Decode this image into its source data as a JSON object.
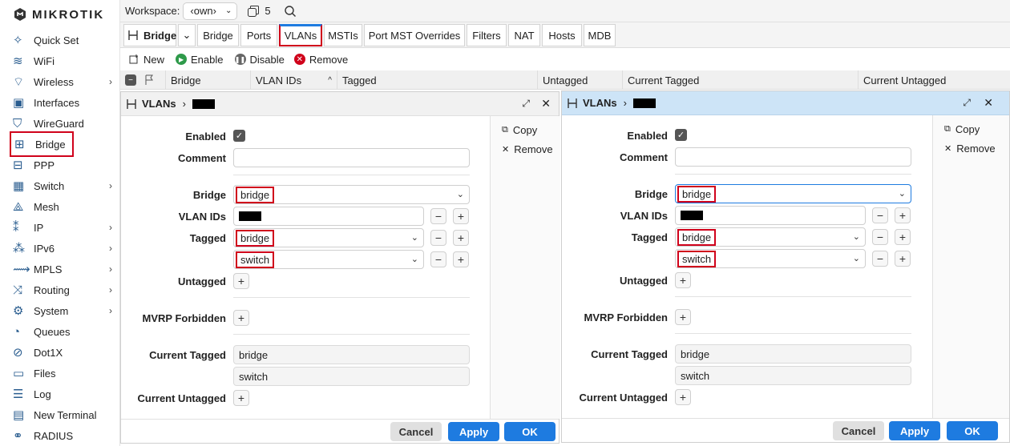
{
  "sidebar": {
    "logo": "MikroTik",
    "items": [
      {
        "label": "Quick Set",
        "icon": "wand-icon",
        "arrow": false
      },
      {
        "label": "WiFi",
        "icon": "wifi-icon",
        "arrow": false
      },
      {
        "label": "Wireless",
        "icon": "wireless-icon",
        "arrow": true
      },
      {
        "label": "Interfaces",
        "icon": "interfaces-icon",
        "arrow": false
      },
      {
        "label": "WireGuard",
        "icon": "wireguard-icon",
        "arrow": false
      },
      {
        "label": "Bridge",
        "icon": "bridge-icon",
        "arrow": false
      },
      {
        "label": "PPP",
        "icon": "ppp-icon",
        "arrow": false
      },
      {
        "label": "Switch",
        "icon": "switch-icon",
        "arrow": true
      },
      {
        "label": "Mesh",
        "icon": "mesh-icon",
        "arrow": false
      },
      {
        "label": "IP",
        "icon": "ip-icon",
        "arrow": true
      },
      {
        "label": "IPv6",
        "icon": "ipv6-icon",
        "arrow": true
      },
      {
        "label": "MPLS",
        "icon": "mpls-icon",
        "arrow": true
      },
      {
        "label": "Routing",
        "icon": "routing-icon",
        "arrow": true
      },
      {
        "label": "System",
        "icon": "gear-icon",
        "arrow": true
      },
      {
        "label": "Queues",
        "icon": "queues-icon",
        "arrow": false
      },
      {
        "label": "Dot1X",
        "icon": "dot1x-icon",
        "arrow": false
      },
      {
        "label": "Files",
        "icon": "folder-icon",
        "arrow": false
      },
      {
        "label": "Log",
        "icon": "log-icon",
        "arrow": false
      },
      {
        "label": "New Terminal",
        "icon": "terminal-icon",
        "arrow": false
      },
      {
        "label": "RADIUS",
        "icon": "radius-icon",
        "arrow": false
      }
    ]
  },
  "topbar": {
    "workspace_label": "Workspace:",
    "workspace_value": "‹own›",
    "windows_count": "5"
  },
  "tabs": {
    "title": "Bridge",
    "items": [
      "Bridge",
      "Ports",
      "VLANs",
      "MSTIs",
      "Port MST Overrides",
      "Filters",
      "NAT",
      "Hosts",
      "MDB"
    ]
  },
  "toolbar": {
    "new": "New",
    "enable": "Enable",
    "disable": "Disable",
    "remove": "Remove"
  },
  "table": {
    "headers": [
      "Bridge",
      "VLAN IDs",
      "Tagged",
      "Untagged",
      "Current Tagged",
      "Current Untagged"
    ]
  },
  "dialog": {
    "title": "VLANs",
    "labels": {
      "enabled": "Enabled",
      "comment": "Comment",
      "bridge": "Bridge",
      "vlan_ids": "VLAN IDs",
      "tagged": "Tagged",
      "untagged": "Untagged",
      "mvrp": "MVRP Forbidden",
      "current_tagged": "Current Tagged",
      "current_untagged": "Current Untagged"
    },
    "values": {
      "bridge": "bridge",
      "tagged1": "bridge",
      "tagged2": "switch",
      "current_tagged1": "bridge",
      "current_tagged2": "switch"
    },
    "actions": {
      "copy": "Copy",
      "remove": "Remove"
    },
    "buttons": {
      "cancel": "Cancel",
      "apply": "Apply",
      "ok": "OK"
    }
  },
  "colors": {
    "accent": "#1e7be0",
    "highlight": "#d0021b",
    "active_header": "#cde4f7"
  }
}
